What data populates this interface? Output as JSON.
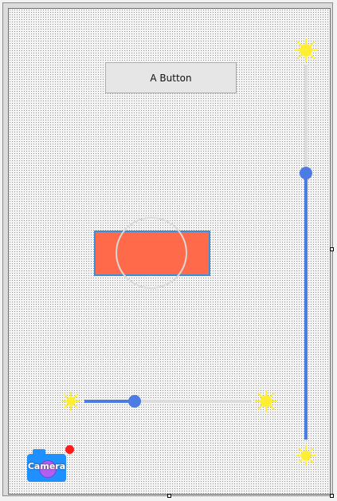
{
  "button": {
    "label": "A Button"
  },
  "camera": {
    "label": "Camera"
  },
  "vertical_slider": {
    "value_fraction": 0.71
  },
  "horizontal_slider": {
    "value_fraction": 0.3
  },
  "colors": {
    "accent": "#4c7be3",
    "track": "#dcdcdc",
    "rectangle_fill": "#ff6b4a",
    "rectangle_border": "#3a8fd8",
    "sun": "#ffee33",
    "camera_body": "#1e90ff",
    "camera_lens": "#b060f0",
    "notification_dot": "#ff1a1a"
  },
  "icons": {
    "slider_max": "sun-icon",
    "slider_min": "sun-icon",
    "camera": "camera-icon"
  }
}
